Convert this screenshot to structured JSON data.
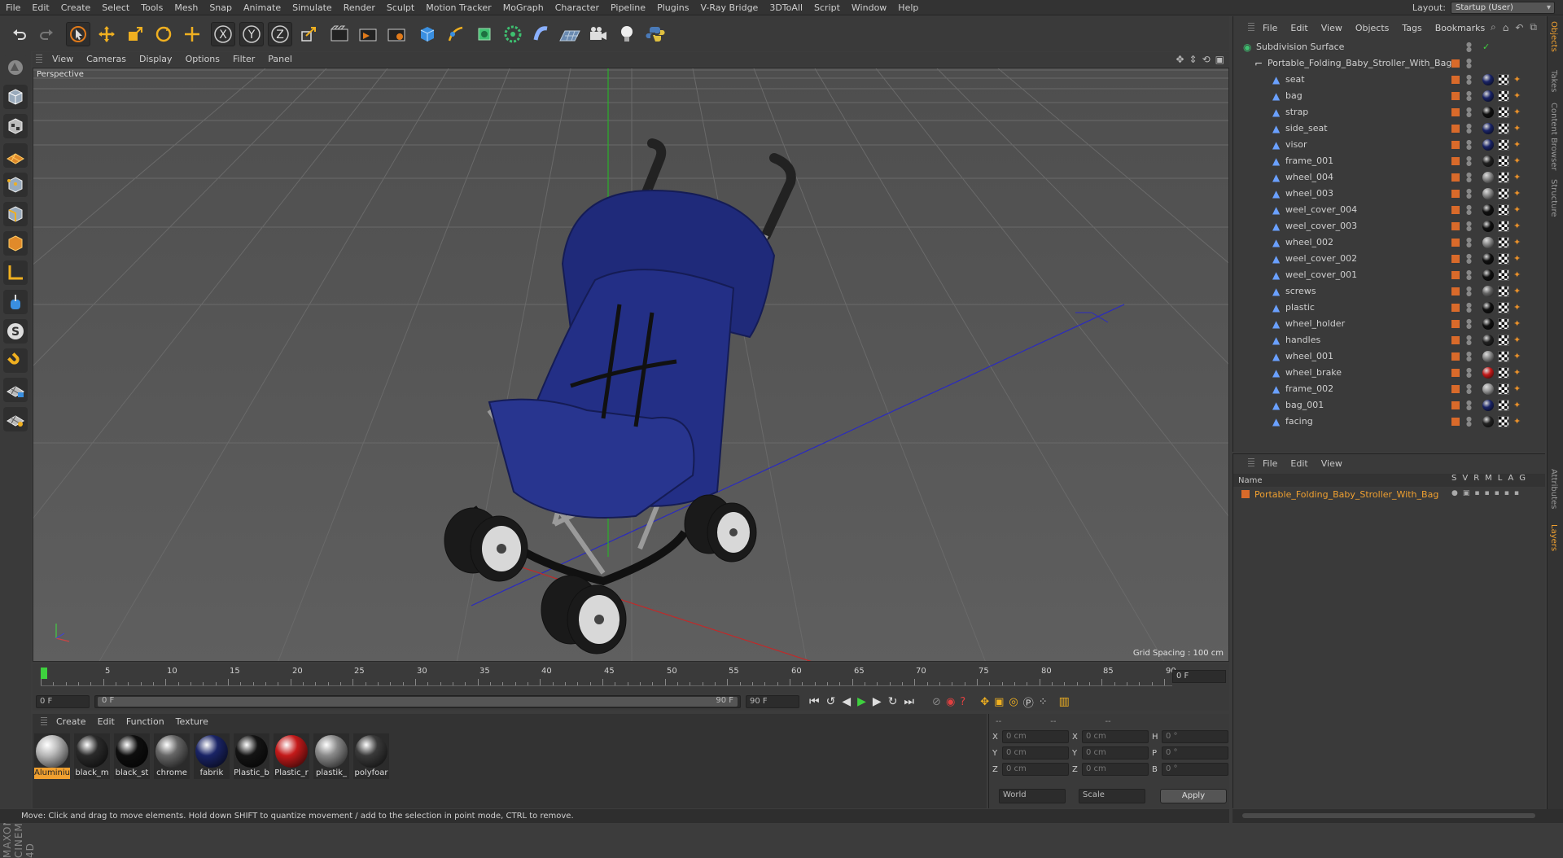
{
  "menubar": {
    "items": [
      "File",
      "Edit",
      "Create",
      "Select",
      "Tools",
      "Mesh",
      "Snap",
      "Animate",
      "Simulate",
      "Render",
      "Sculpt",
      "Motion Tracker",
      "MoGraph",
      "Character",
      "Pipeline",
      "Plugins",
      "V-Ray Bridge",
      "3DToAll",
      "Script",
      "Window",
      "Help"
    ],
    "layout_label": "Layout:",
    "layout_value": "Startup (User)"
  },
  "viewport": {
    "menu": [
      "View",
      "Cameras",
      "Display",
      "Options",
      "Filter",
      "Panel"
    ],
    "label": "Perspective",
    "grid_spacing": "Grid Spacing : 100 cm"
  },
  "timeline": {
    "ticks": [
      "0",
      "5",
      "10",
      "15",
      "20",
      "25",
      "30",
      "35",
      "40",
      "45",
      "50",
      "55",
      "60",
      "65",
      "70",
      "75",
      "80",
      "85",
      "90"
    ],
    "current_frame": "0 F",
    "start_field": "0 F",
    "range_start": "0 F",
    "range_end": "90 F",
    "end_field": "90 F"
  },
  "materials": {
    "menu": [
      "Create",
      "Edit",
      "Function",
      "Texture"
    ],
    "items": [
      {
        "name": "Aluminiu",
        "color": "#b8b8b8",
        "selected": true
      },
      {
        "name": "black_m",
        "color": "#2a2a2a",
        "selected": false
      },
      {
        "name": "black_st",
        "color": "#0e0e0e",
        "selected": false
      },
      {
        "name": "chrome",
        "color": "#666666",
        "selected": false
      },
      {
        "name": "fabrik",
        "color": "#1a2466",
        "selected": false
      },
      {
        "name": "Plastic_b",
        "color": "#141414",
        "selected": false
      },
      {
        "name": "Plastic_r",
        "color": "#c41a1a",
        "selected": false
      },
      {
        "name": "plastik_",
        "color": "#8a8a8a",
        "selected": false
      },
      {
        "name": "polyfoar",
        "color": "#3a3a3a",
        "selected": false
      }
    ]
  },
  "coords": {
    "header_a": "--",
    "header_b": "--",
    "header_c": "--",
    "rows": [
      {
        "a": "X",
        "av": "0 cm",
        "b": "X",
        "bv": "0 cm",
        "c": "H",
        "cv": "0 °"
      },
      {
        "a": "Y",
        "av": "0 cm",
        "b": "Y",
        "bv": "0 cm",
        "c": "P",
        "cv": "0 °"
      },
      {
        "a": "Z",
        "av": "0 cm",
        "b": "Z",
        "bv": "0 cm",
        "c": "B",
        "cv": "0 °"
      }
    ],
    "world": "World",
    "scale": "Scale",
    "apply": "Apply"
  },
  "status": "Move: Click and drag to move elements. Hold down SHIFT to quantize movement / add to the selection in point mode, CTRL to remove.",
  "objects": {
    "menu": [
      "File",
      "Edit",
      "View",
      "Objects",
      "Tags",
      "Bookmarks"
    ],
    "root": "Subdivision Surface",
    "group": "Portable_Folding_Baby_Stroller_With_Bag",
    "children": [
      {
        "name": "seat",
        "mat": "#1a2466"
      },
      {
        "name": "bag",
        "mat": "#1a2466"
      },
      {
        "name": "strap",
        "mat": "#111111"
      },
      {
        "name": "side_seat",
        "mat": "#1a2466"
      },
      {
        "name": "visor",
        "mat": "#1a2466"
      },
      {
        "name": "frame_001",
        "mat": "#222222"
      },
      {
        "name": "wheel_004",
        "mat": "#888888"
      },
      {
        "name": "wheel_003",
        "mat": "#888888"
      },
      {
        "name": "weel_cover_004",
        "mat": "#111111"
      },
      {
        "name": "weel_cover_003",
        "mat": "#111111"
      },
      {
        "name": "wheel_002",
        "mat": "#888888"
      },
      {
        "name": "weel_cover_002",
        "mat": "#111111"
      },
      {
        "name": "weel_cover_001",
        "mat": "#111111"
      },
      {
        "name": "screws",
        "mat": "#666666"
      },
      {
        "name": "plastic",
        "mat": "#111111"
      },
      {
        "name": "wheel_holder",
        "mat": "#111111"
      },
      {
        "name": "handles",
        "mat": "#222222"
      },
      {
        "name": "wheel_001",
        "mat": "#888888"
      },
      {
        "name": "wheel_brake",
        "mat": "#c41a1a"
      },
      {
        "name": "frame_002",
        "mat": "#999999"
      },
      {
        "name": "bag_001",
        "mat": "#1a2466"
      },
      {
        "name": "facing",
        "mat": "#222222"
      }
    ]
  },
  "layers": {
    "menu": [
      "File",
      "Edit",
      "View"
    ],
    "col_name": "Name",
    "cols": [
      "S",
      "V",
      "R",
      "M",
      "L",
      "A",
      "G"
    ],
    "row": "Portable_Folding_Baby_Stroller_With_Bag"
  },
  "side_tabs": [
    "Objects",
    "Takes",
    "Content Browser",
    "Structure",
    "Attributes",
    "Layers"
  ],
  "brand": "MAXON CINEMA 4D"
}
